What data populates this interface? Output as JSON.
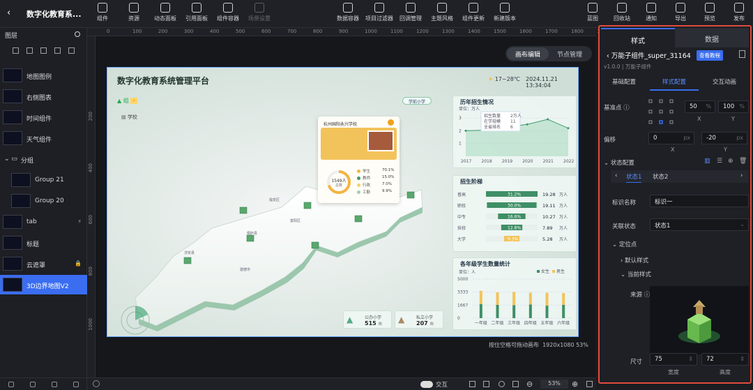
{
  "app": {
    "title": "数字化教育系...",
    "back": "‹"
  },
  "toolbar": {
    "left": [
      "组件",
      "资源",
      "动态面板",
      "引用面板",
      "组件容器",
      "场景设置"
    ],
    "center": [
      "数据容器",
      "项目过滤器",
      "回调管理",
      "主题风格",
      "组件更新",
      "新建版本"
    ],
    "right": [
      "蓝图",
      "回收站",
      "通知",
      "导出",
      "预览",
      "发布"
    ]
  },
  "layers": {
    "title": "图层",
    "items": [
      {
        "label": "地图图例"
      },
      {
        "label": "右侧图表"
      },
      {
        "label": "时间组件"
      },
      {
        "label": "天气组件"
      },
      {
        "label": "分组"
      },
      {
        "label": "Group 21"
      },
      {
        "label": "Group 20"
      },
      {
        "label": "tab"
      },
      {
        "label": "标题"
      },
      {
        "label": "云遮罩"
      },
      {
        "label": "3D边界地图V2"
      }
    ]
  },
  "canvas": {
    "view_tabs": [
      "画布编辑",
      "节点管理"
    ],
    "ruler_h": [
      "0",
      "100",
      "200",
      "300",
      "400",
      "500",
      "600",
      "700",
      "800",
      "900",
      "1000",
      "1100",
      "1200",
      "1300",
      "1400",
      "1500",
      "1600",
      "1700",
      "1800",
      "1900"
    ],
    "ruler_v": [
      "200",
      "400",
      "600",
      "800",
      "1000"
    ],
    "hint": "按住空格可拖动画布",
    "size_info": "1920x1080 53%",
    "zoom": "53%",
    "interact_label": "交互"
  },
  "dashboard": {
    "title": "数字化教育系统管理平台",
    "weather": "17~28℃",
    "datetime": "2024.11.21 13:34:04",
    "legend": [
      "组",
      "学校"
    ],
    "school_chip": "学前小学",
    "popup": {
      "name": "杭州国阳永兴学校",
      "count": "1549人",
      "count_sub": "总数",
      "stats": [
        [
          "学生",
          "70.1%"
        ],
        [
          "教师",
          "15.0%"
        ],
        [
          "行政",
          "7.0%"
        ],
        [
          "工勤",
          "9.9%"
        ]
      ]
    },
    "map_labels": [
      "临安区",
      "富阳区",
      "桐庐县",
      "淳安县",
      "建德市",
      "余杭区"
    ],
    "bottom_cards": [
      {
        "label": "公办小学",
        "value": "515",
        "unit": "所"
      },
      {
        "label": "私立小学",
        "value": "207",
        "unit": "所"
      }
    ]
  },
  "chart_data": [
    {
      "type": "area",
      "title": "历年招生情况",
      "ylabel": "单位：万人",
      "x": [
        "2017",
        "2018",
        "2019",
        "2020",
        "2021",
        "2022"
      ],
      "y_ticks": [
        "1",
        "2",
        "3"
      ],
      "series": [
        {
          "values": [
            2.0,
            2.05,
            2.3,
            2.5,
            2.9,
            2.2
          ]
        }
      ],
      "tooltip": [
        [
          "招生数量",
          "2万人"
        ],
        [
          "在学规模",
          "11"
        ],
        [
          "全省排名",
          "6"
        ]
      ]
    },
    {
      "type": "bar",
      "title": "招生阶梯",
      "categories": [
        "普高",
        "职校",
        "中专",
        "技校",
        "大学"
      ],
      "percent": [
        "31.2%",
        "30.0%",
        "16.6%",
        "12.8%",
        "9.3%"
      ],
      "values": [
        "19.28",
        "19.11",
        "10.27",
        "7.89",
        "5.28"
      ],
      "unit": "万人"
    },
    {
      "type": "bar",
      "title": "各年级学生数量统计",
      "ylabel": "单位：人",
      "categories": [
        "一年级",
        "二年级",
        "三年级",
        "四年级",
        "五年级",
        "六年级"
      ],
      "y_ticks": [
        "0",
        "1667",
        "3333",
        "5000"
      ],
      "series": [
        {
          "name": "女生",
          "values": [
            1800,
            1700,
            1650,
            1750,
            1600,
            1700
          ]
        },
        {
          "name": "男生",
          "values": [
            1700,
            1600,
            1700,
            1500,
            1650,
            1500
          ]
        }
      ]
    }
  ],
  "right_panel": {
    "tabs": [
      "样式",
      "数据"
    ],
    "component": "万能子组件_super_31164",
    "tutorial": "查看教程",
    "version": "v1.0.0 | 万能子组件",
    "sub_tabs": [
      "基础配置",
      "样式配置",
      "交互动画"
    ],
    "anchor_label": "基准点",
    "anchor_x": "50",
    "anchor_y": "100",
    "pct": "%",
    "offset_label": "偏移",
    "offset_x": "0",
    "offset_y": "-20",
    "px": "px",
    "x_label": "X",
    "y_label": "Y",
    "state_config": "状态配置",
    "states": [
      "状态1",
      "状态2"
    ],
    "id_name_label": "标识名称",
    "id_name_value": "标识一",
    "linked_state_label": "关联状态",
    "linked_state_value": "状态1",
    "position_label": "定位点",
    "default_style": "默认样式",
    "current_style": "当前样式",
    "source_label": "来源",
    "size_label": "尺寸",
    "width": "75",
    "height": "72",
    "width_label": "宽度",
    "height_label": "高度"
  }
}
